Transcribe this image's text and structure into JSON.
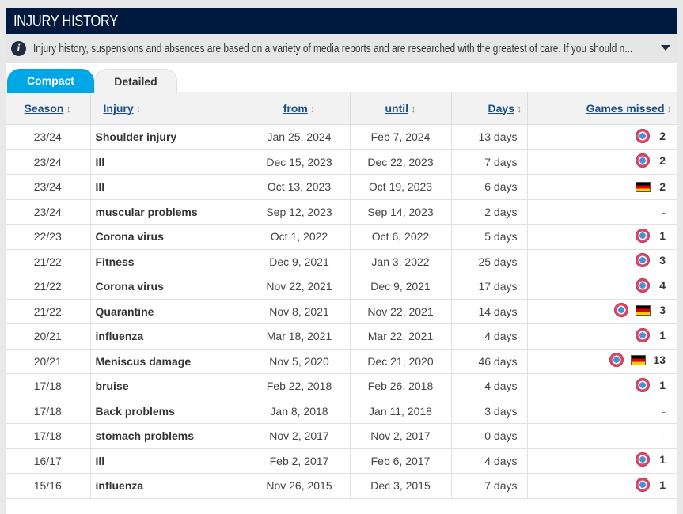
{
  "header": {
    "title": "INJURY HISTORY"
  },
  "info": {
    "icon": "info-icon",
    "text": "Injury history, suspensions and absences are based on a variety of media reports and are researched with the greatest of care. If you should n...",
    "toggle_icon": "caret-down-icon"
  },
  "tabs": [
    {
      "label": "Compact",
      "active": true
    },
    {
      "label": "Detailed",
      "active": false
    }
  ],
  "table": {
    "columns": [
      "Season",
      "Injury",
      "from",
      "until",
      "Days",
      "Games missed"
    ],
    "sort_icon": "↕",
    "rows": [
      {
        "season": "23/24",
        "injury": "Shoulder injury",
        "from": "Jan 25, 2024",
        "until": "Feb 7, 2024",
        "days": "13 days",
        "icons": [
          "club"
        ],
        "games": "2"
      },
      {
        "season": "23/24",
        "injury": "Ill",
        "from": "Dec 15, 2023",
        "until": "Dec 22, 2023",
        "days": "7 days",
        "icons": [
          "club"
        ],
        "games": "2"
      },
      {
        "season": "23/24",
        "injury": "Ill",
        "from": "Oct 13, 2023",
        "until": "Oct 19, 2023",
        "days": "6 days",
        "icons": [
          "flag"
        ],
        "games": "2"
      },
      {
        "season": "23/24",
        "injury": "muscular problems",
        "from": "Sep 12, 2023",
        "until": "Sep 14, 2023",
        "days": "2 days",
        "icons": [],
        "games": "-"
      },
      {
        "season": "22/23",
        "injury": "Corona virus",
        "from": "Oct 1, 2022",
        "until": "Oct 6, 2022",
        "days": "5 days",
        "icons": [
          "club"
        ],
        "games": "1"
      },
      {
        "season": "21/22",
        "injury": "Fitness",
        "from": "Dec 9, 2021",
        "until": "Jan 3, 2022",
        "days": "25 days",
        "icons": [
          "club"
        ],
        "games": "3"
      },
      {
        "season": "21/22",
        "injury": "Corona virus",
        "from": "Nov 22, 2021",
        "until": "Dec 9, 2021",
        "days": "17 days",
        "icons": [
          "club"
        ],
        "games": "4"
      },
      {
        "season": "21/22",
        "injury": "Quarantine",
        "from": "Nov 8, 2021",
        "until": "Nov 22, 2021",
        "days": "14 days",
        "icons": [
          "club",
          "flag"
        ],
        "games": "3"
      },
      {
        "season": "20/21",
        "injury": "influenza",
        "from": "Mar 18, 2021",
        "until": "Mar 22, 2021",
        "days": "4 days",
        "icons": [
          "club"
        ],
        "games": "1"
      },
      {
        "season": "20/21",
        "injury": "Meniscus damage",
        "from": "Nov 5, 2020",
        "until": "Dec 21, 2020",
        "days": "46 days",
        "icons": [
          "club",
          "flag"
        ],
        "games": "13"
      },
      {
        "season": "17/18",
        "injury": "bruise",
        "from": "Feb 22, 2018",
        "until": "Feb 26, 2018",
        "days": "4 days",
        "icons": [
          "club"
        ],
        "games": "1"
      },
      {
        "season": "17/18",
        "injury": "Back problems",
        "from": "Jan 8, 2018",
        "until": "Jan 11, 2018",
        "days": "3 days",
        "icons": [],
        "games": "-"
      },
      {
        "season": "17/18",
        "injury": "stomach problems",
        "from": "Nov 2, 2017",
        "until": "Nov 2, 2017",
        "days": "0 days",
        "icons": [],
        "games": "-"
      },
      {
        "season": "16/17",
        "injury": "Ill",
        "from": "Feb 2, 2017",
        "until": "Feb 6, 2017",
        "days": "4 days",
        "icons": [
          "club"
        ],
        "games": "1"
      },
      {
        "season": "15/16",
        "injury": "influenza",
        "from": "Nov 26, 2015",
        "until": "Dec 3, 2015",
        "days": "7 days",
        "icons": [
          "club"
        ],
        "games": "1"
      }
    ]
  },
  "colors": {
    "header_bg": "#001a3f",
    "tab_active": "#00a7e6",
    "link": "#1a4f8a"
  }
}
